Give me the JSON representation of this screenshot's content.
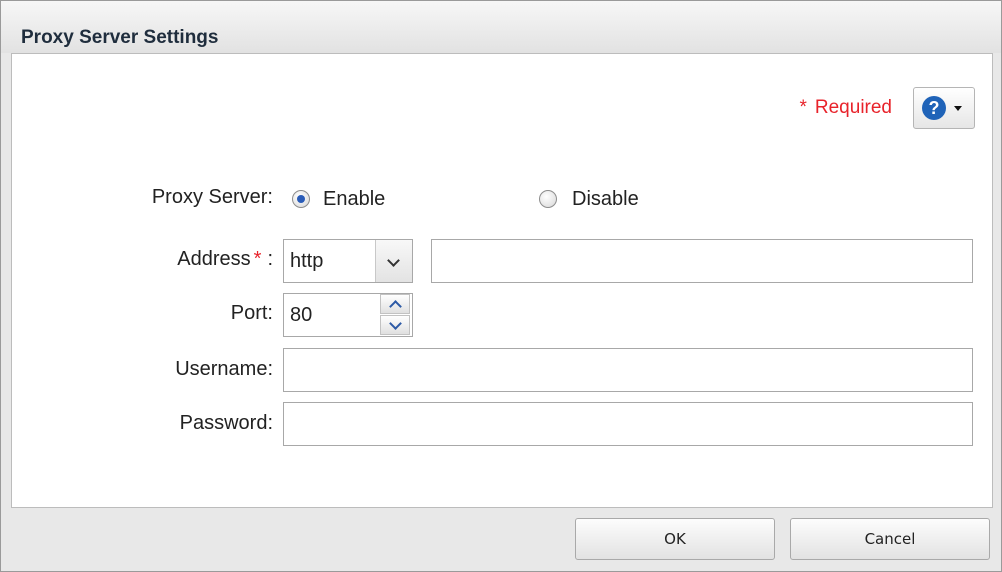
{
  "dialog": {
    "title": "Proxy Server Settings"
  },
  "required": {
    "star": "*",
    "label": "Required"
  },
  "help": {
    "icon": "question-icon",
    "glyph": "?"
  },
  "proxy_server": {
    "label": "Proxy Server:",
    "options": [
      {
        "label": "Enable",
        "selected": true
      },
      {
        "label": "Disable",
        "selected": false
      }
    ]
  },
  "address": {
    "label": "Address",
    "required_star": "*",
    "colon": ":",
    "protocol": "http",
    "value": ""
  },
  "port": {
    "label": "Port:",
    "value": "80"
  },
  "username": {
    "label": "Username:",
    "value": ""
  },
  "password": {
    "label": "Password:",
    "value": ""
  },
  "buttons": {
    "ok": "OK",
    "cancel": "Cancel"
  },
  "colors": {
    "required": "#e8232b",
    "help_blue": "#1f63b8",
    "radio_selected": "#2a5cb8"
  }
}
